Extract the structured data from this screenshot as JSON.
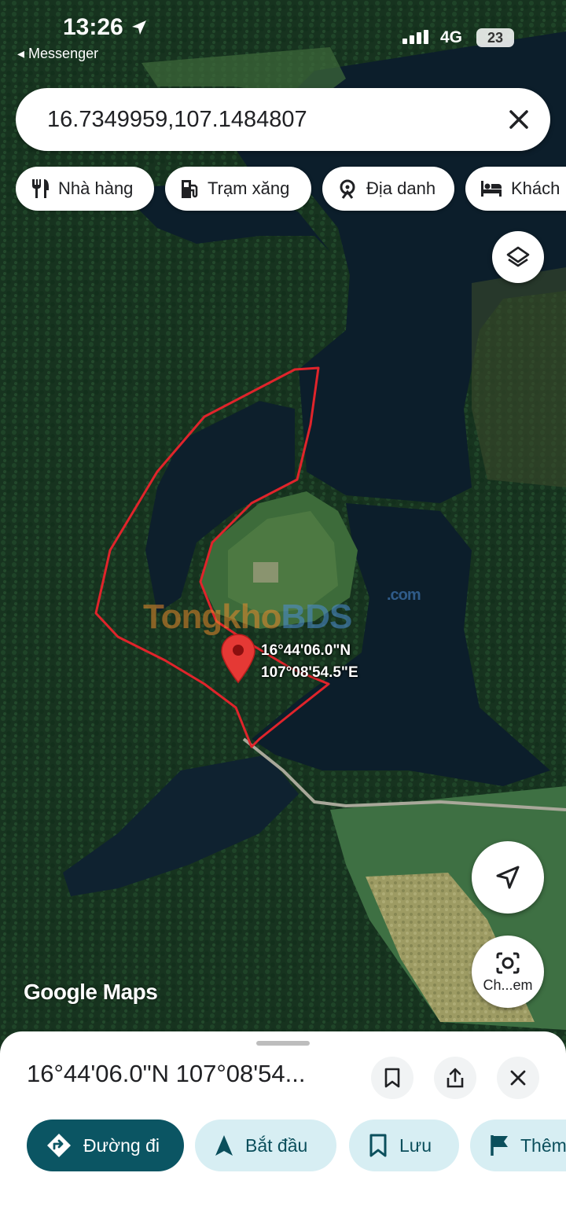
{
  "status_bar": {
    "time": "13:26",
    "back_app": "Messenger",
    "network": "4G",
    "battery": "23"
  },
  "search": {
    "query": "16.7349959,107.1484807"
  },
  "chips": [
    {
      "label": "Nhà hàng",
      "icon": "restaurant-icon"
    },
    {
      "label": "Trạm xăng",
      "icon": "gas-station-icon"
    },
    {
      "label": "Địa danh",
      "icon": "landmark-icon"
    },
    {
      "label": "Khách",
      "icon": "hotel-icon"
    }
  ],
  "map": {
    "pin_label_lat": "16°44'06.0\"N",
    "pin_label_lng": "107°08'54.5\"E",
    "logo": "Google Maps",
    "watermark": {
      "part1": "Tongkho",
      "part2": "BDS",
      "suffix": ".com"
    },
    "lens_button_label": "Ch...em"
  },
  "sheet": {
    "title": "16°44'06.0\"N 107°08'54...",
    "actions": [
      {
        "label": "Đường đi",
        "icon": "directions-icon"
      },
      {
        "label": "Bắt đầu",
        "icon": "navigation-arrow-icon"
      },
      {
        "label": "Lưu",
        "icon": "bookmark-icon"
      },
      {
        "label": "Thêm",
        "icon": "flag-icon"
      }
    ]
  },
  "colors": {
    "primary_action": "#0b5563",
    "secondary_action": "#d7eef3",
    "pin": "#e53935",
    "drawn_outline": "#e0242b"
  }
}
